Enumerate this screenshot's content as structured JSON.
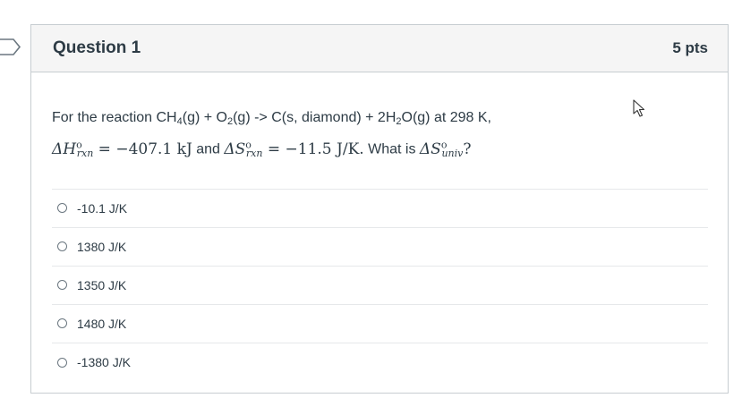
{
  "question": {
    "title": "Question 1",
    "points": "5 pts",
    "text_part1": "For the reaction CH",
    "sub_4": "4",
    "text_part2": "(g) + O",
    "sub_2a": "2",
    "text_part3": "(g) -> C(s, diamond) + 2H",
    "sub_2b": "2",
    "text_part4": "O(g) at 298 K,",
    "math_dh": "ΔH",
    "math_dh_sub": "rxn",
    "math_sup_o": "o",
    "math_dh_value": " = −407.1 kJ",
    "and_text": " and ",
    "math_ds": "ΔS",
    "math_ds_sub": "rxn",
    "math_ds_value": " = −11.5 J/K.",
    "what_is": " What is ",
    "math_dsu": "ΔS",
    "math_dsu_sub": "univ",
    "question_mark": "?"
  },
  "answers": [
    {
      "label": "-10.1 J/K"
    },
    {
      "label": "1380 J/K"
    },
    {
      "label": "1350 J/K"
    },
    {
      "label": "1480 J/K"
    },
    {
      "label": "-1380 J/K"
    }
  ],
  "icons": {
    "flag": "bookmark-flag-icon",
    "cursor": "mouse-pointer-icon"
  },
  "colors": {
    "header_bg": "#f5f5f5",
    "border": "#c7cdd1",
    "text": "#2d3b45",
    "divider": "#e6e8ea"
  }
}
